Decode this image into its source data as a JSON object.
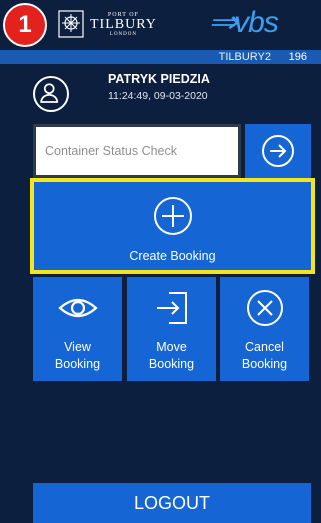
{
  "colors": {
    "background": "#0c1f3f",
    "tile": "#1565d4",
    "highlight": "#f5e61a",
    "badge": "#e3221d",
    "vbs_logo": "#3aa0f2"
  },
  "header": {
    "step_number": "1",
    "port_of": "PORT OF",
    "tilbury": "TILBURY",
    "london": "LONDON",
    "vbs_logo": "vbs",
    "terminal_id": "TILBURY2",
    "terminal_count": "196"
  },
  "user": {
    "name": "PATRYK PIEDZIA",
    "timestamp": "11:24:49, 09-03-2020"
  },
  "status_check": {
    "placeholder": "Container Status Check",
    "value": ""
  },
  "actions": {
    "create": "Create Booking",
    "view": "View Booking",
    "move": "Move Booking",
    "cancel": "Cancel Booking",
    "view_line1": "View",
    "view_line2": "Booking",
    "move_line1": "Move",
    "move_line2": "Booking",
    "cancel_line1": "Cancel",
    "cancel_line2": "Booking"
  },
  "logout": "LOGOUT",
  "icons": {
    "avatar": "user-icon",
    "go": "arrow-right-circle-icon",
    "create": "plus-circle-icon",
    "view": "eye-icon",
    "move": "login-arrow-icon",
    "cancel": "x-circle-icon"
  }
}
